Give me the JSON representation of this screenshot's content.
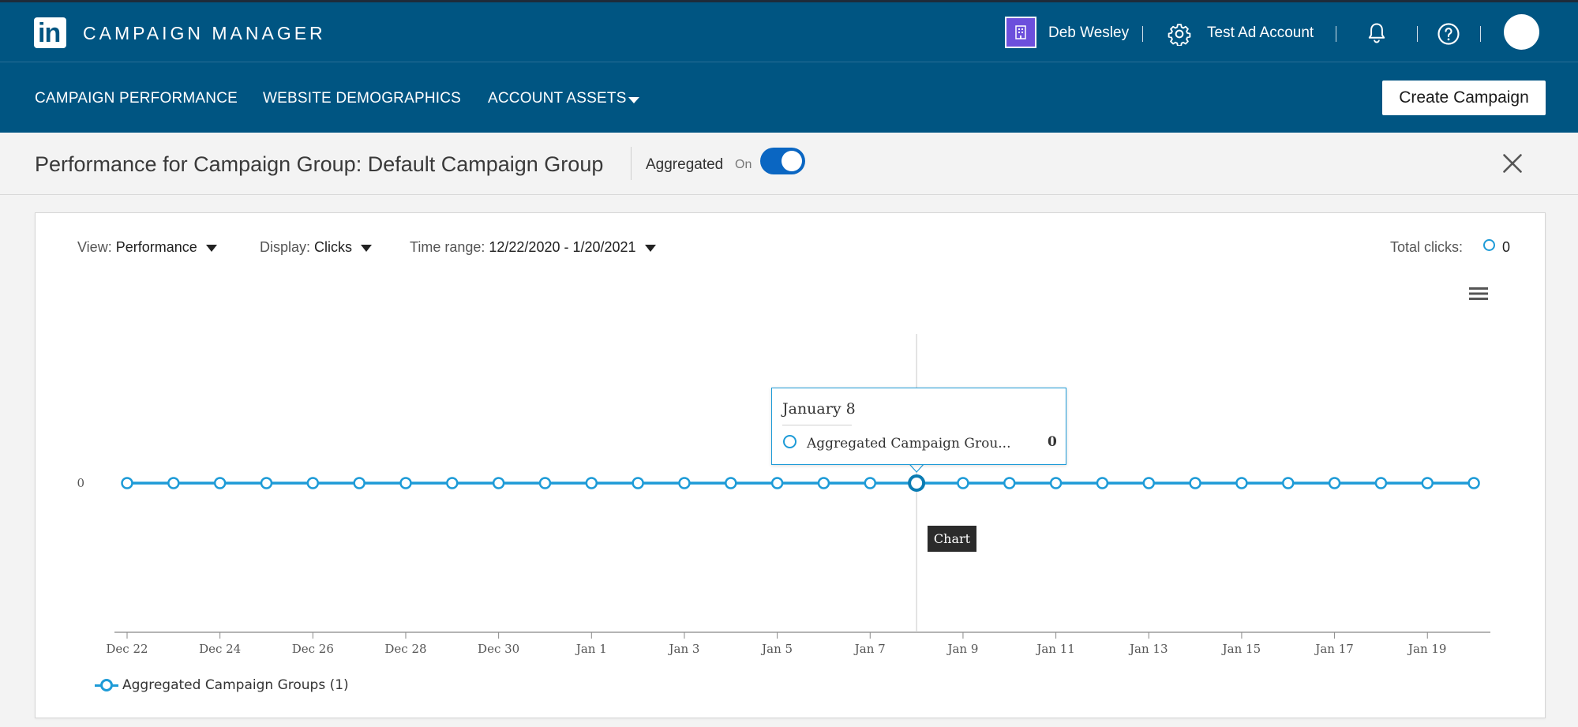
{
  "header": {
    "app_title": "CAMPAIGN MANAGER",
    "logo_text": "in",
    "user_name": "Deb Wesley",
    "account_name": "Test Ad Account"
  },
  "nav": {
    "items": [
      "CAMPAIGN PERFORMANCE",
      "WEBSITE DEMOGRAPHICS",
      "ACCOUNT ASSETS"
    ],
    "create_button": "Create Campaign"
  },
  "subheader": {
    "title": "Performance for Campaign Group: Default Campaign Group",
    "aggregated_label": "Aggregated",
    "toggle_state": "On"
  },
  "controls": {
    "view_label": "View:",
    "view_value": "Performance",
    "display_label": "Display:",
    "display_value": "Clicks",
    "time_label": "Time range:",
    "time_value": "12/22/2020 - 1/20/2021",
    "total_label": "Total clicks:",
    "total_value": "0"
  },
  "tooltip": {
    "title": "January 8",
    "series": "Aggregated Campaign Grou...",
    "value": "0"
  },
  "chart_tip": "Chart",
  "colors": {
    "header_bg": "#005582",
    "series": "#1e9bd7",
    "toggle": "#0a66c2"
  },
  "chart_data": {
    "type": "line",
    "title": "",
    "xlabel": "",
    "ylabel": "",
    "x": [
      "2020-12-22",
      "2020-12-23",
      "2020-12-24",
      "2020-12-25",
      "2020-12-26",
      "2020-12-27",
      "2020-12-28",
      "2020-12-29",
      "2020-12-30",
      "2020-12-31",
      "2021-01-01",
      "2021-01-02",
      "2021-01-03",
      "2021-01-04",
      "2021-01-05",
      "2021-01-06",
      "2021-01-07",
      "2021-01-08",
      "2021-01-09",
      "2021-01-10",
      "2021-01-11",
      "2021-01-12",
      "2021-01-13",
      "2021-01-14",
      "2021-01-15",
      "2021-01-16",
      "2021-01-17",
      "2021-01-18",
      "2021-01-19",
      "2021-01-20"
    ],
    "x_tick_labels": [
      "Dec 22",
      "Dec 24",
      "Dec 26",
      "Dec 28",
      "Dec 30",
      "Jan 1",
      "Jan 3",
      "Jan 5",
      "Jan 7",
      "Jan 9",
      "Jan 11",
      "Jan 13",
      "Jan 15",
      "Jan 17",
      "Jan 19"
    ],
    "y_tick_labels": [
      "0"
    ],
    "series": [
      {
        "name": "Aggregated Campaign Groups (1)",
        "values": [
          0,
          0,
          0,
          0,
          0,
          0,
          0,
          0,
          0,
          0,
          0,
          0,
          0,
          0,
          0,
          0,
          0,
          0,
          0,
          0,
          0,
          0,
          0,
          0,
          0,
          0,
          0,
          0,
          0,
          0
        ]
      }
    ],
    "highlighted_x": "2021-01-08",
    "legend_position": "bottom-left",
    "grid": false
  }
}
